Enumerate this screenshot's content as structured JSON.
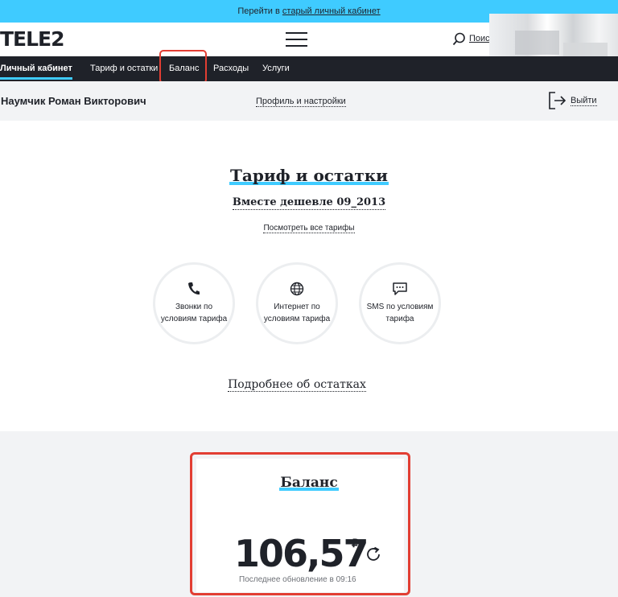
{
  "topbar": {
    "prefix": "Перейти в",
    "link": "старый личный кабинет"
  },
  "header": {
    "logo": "TELE2",
    "search_label": "Поиск"
  },
  "nav": {
    "items": [
      {
        "label": "Личный кабинет"
      },
      {
        "label": "Тариф и остатки"
      },
      {
        "label": "Баланс"
      },
      {
        "label": "Расходы"
      },
      {
        "label": "Услуги"
      }
    ]
  },
  "profile": {
    "name": "Наумчик Роман Викторович",
    "settings_link": "Профиль и настройки",
    "logout": "Выйти"
  },
  "tariff": {
    "title": "Тариф и остатки",
    "name": "Вместе дешевле 09_2013",
    "all_tariffs": "Посмотреть все тарифы",
    "circles": [
      {
        "icon": "phone-icon",
        "text": "Звонки по условиям тарифа"
      },
      {
        "icon": "globe-icon",
        "text": "Интернет по условиям тарифа"
      },
      {
        "icon": "chat-icon",
        "text": "SMS по условиям тарифа"
      }
    ],
    "more_link": "Подробнее об остатках"
  },
  "balance": {
    "title": "Баланс",
    "amount": "106,57",
    "currency": "₽",
    "last_update": "Последнее обновление в 09:16"
  },
  "colors": {
    "accent": "#3fcbff",
    "dark": "#1f2229",
    "highlight": "#e23e33"
  }
}
